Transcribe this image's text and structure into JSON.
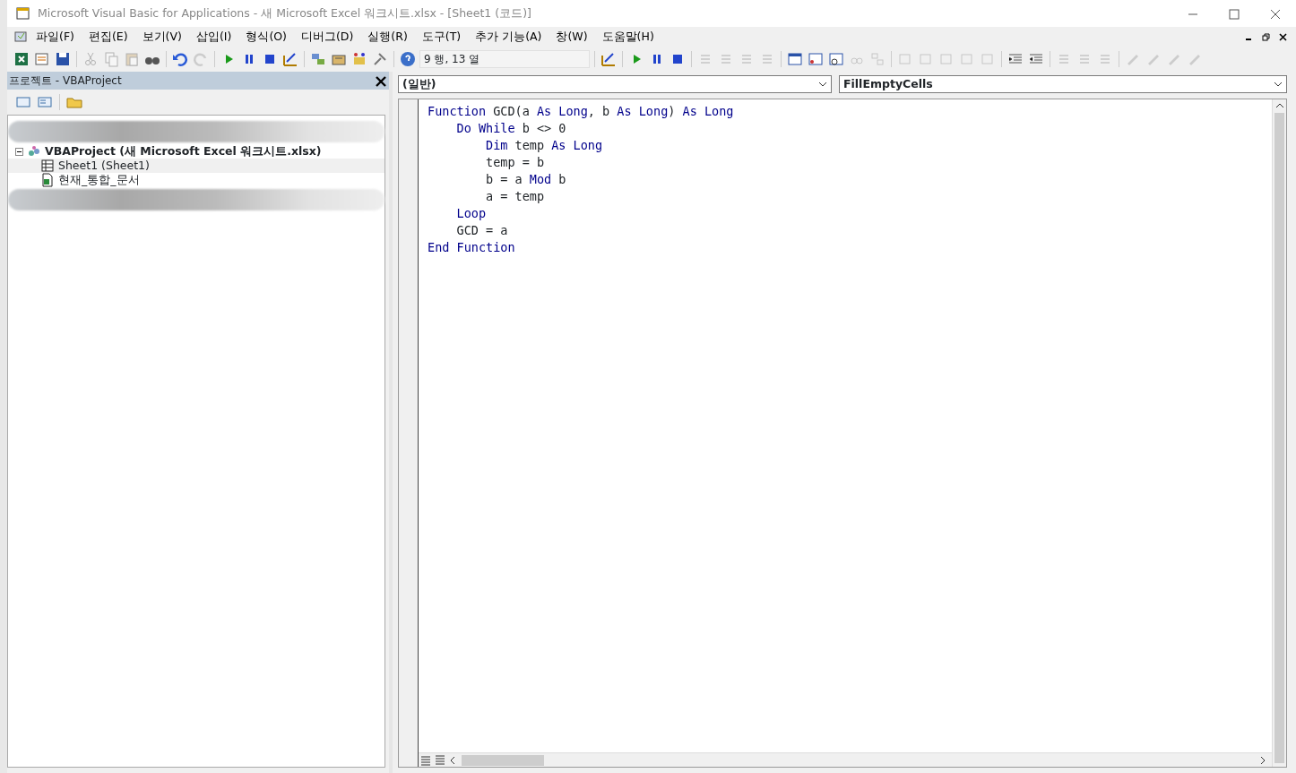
{
  "window": {
    "title": "Microsoft Visual Basic for Applications - 새 Microsoft Excel 워크시트.xlsx - [Sheet1 (코드)]"
  },
  "menu": [
    "파일(F)",
    "편집(E)",
    "보기(V)",
    "삽입(I)",
    "형식(O)",
    "디버그(D)",
    "실행(R)",
    "도구(T)",
    "추가 기능(A)",
    "창(W)",
    "도움말(H)"
  ],
  "toolbar": {
    "position": "9 행, 13 열"
  },
  "project_panel": {
    "title": "프로젝트 - VBAProject",
    "tree": [
      {
        "label": "VBAProject (새 Microsoft Excel 워크시트.xlsx)",
        "expanded": true,
        "children": [
          {
            "label": "Sheet1 (Sheet1)",
            "kind": "sheet",
            "selected": true
          },
          {
            "label": "현재_통합_문서",
            "kind": "workbook",
            "selected": false
          }
        ]
      }
    ]
  },
  "code_window": {
    "object": "(일반)",
    "procedure": "FillEmptyCells",
    "lines": [
      [
        {
          "text": "Function",
          "kind": "keyword"
        },
        {
          "text": " GCD(a ",
          "kind": "plain"
        },
        {
          "text": "As Long",
          "kind": "keyword"
        },
        {
          "text": ", b ",
          "kind": "plain"
        },
        {
          "text": "As Long",
          "kind": "keyword"
        },
        {
          "text": ") ",
          "kind": "plain"
        },
        {
          "text": "As Long",
          "kind": "keyword"
        }
      ],
      [
        {
          "text": "    Do While",
          "kind": "keyword"
        },
        {
          "text": " b <> 0",
          "kind": "plain"
        }
      ],
      [
        {
          "text": "        Dim",
          "kind": "keyword"
        },
        {
          "text": " temp ",
          "kind": "plain"
        },
        {
          "text": "As Long",
          "kind": "keyword"
        }
      ],
      [
        {
          "text": "        temp = b",
          "kind": "plain"
        }
      ],
      [
        {
          "text": "        b = a ",
          "kind": "plain"
        },
        {
          "text": "Mod",
          "kind": "keyword"
        },
        {
          "text": " b",
          "kind": "plain"
        }
      ],
      [
        {
          "text": "        a = temp",
          "kind": "plain"
        }
      ],
      [
        {
          "text": "    Loop",
          "kind": "keyword"
        }
      ],
      [
        {
          "text": "    GCD = a",
          "kind": "plain"
        }
      ],
      [
        {
          "text": "End Function",
          "kind": "keyword"
        }
      ]
    ]
  }
}
